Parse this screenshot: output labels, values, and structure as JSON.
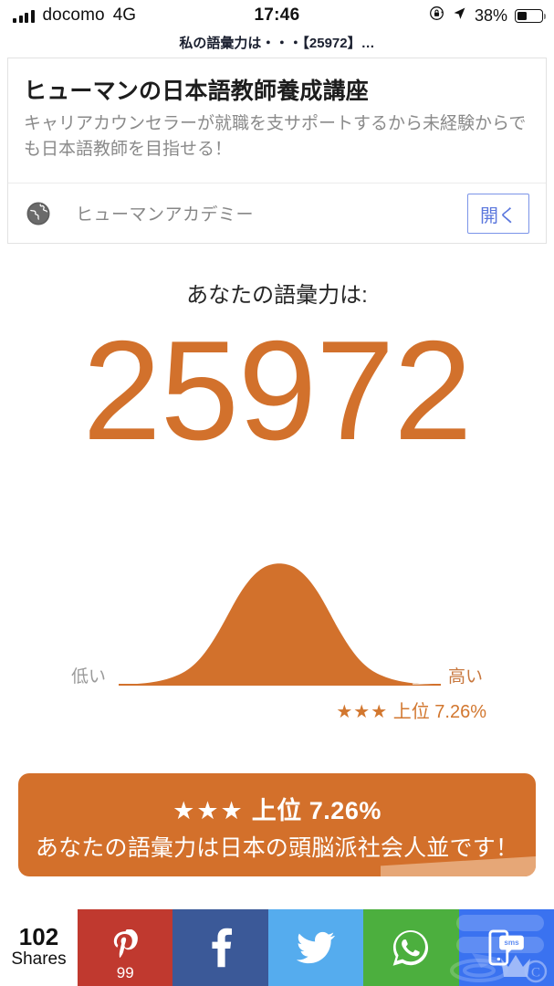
{
  "status_bar": {
    "carrier": "docomo",
    "network": "4G",
    "time": "17:46",
    "battery_percent": "38%",
    "battery_level": 38,
    "icons": [
      "signal-bars-icon",
      "orientation-lock-icon",
      "location-arrow-icon",
      "battery-icon"
    ]
  },
  "page_title": "私の語彙力は・・・【25972】…",
  "ad": {
    "title": "ヒューマンの日本語教師養成講座",
    "description": "キャリアカウンセラーが就職を支サポートするから未経験からでも日本語教師を目指せる！",
    "advertiser": "ヒューマンアカデミー",
    "advertiser_icon": "globe-icon",
    "open_label": "開く",
    "open_color": "#5b77dd"
  },
  "result": {
    "score_label": "あなたの語彙力は:",
    "score": "25972",
    "score_color": "#d2712c",
    "rank_stars": "★★★",
    "rank_text": "上位 7.26%",
    "rank_percent": 7.26,
    "banner_headline_stars": "★★★",
    "banner_headline_text": "上位 7.26%",
    "banner_subtitle": "あなたの語彙力は日本の頭脳派社会人並です！",
    "banner_color": "#d3702b"
  },
  "chart_data": {
    "type": "area",
    "title": "",
    "xlabel": "",
    "ylabel": "",
    "axis_labels": {
      "left": "低い",
      "right": "高い"
    },
    "fill_color": "#d2712c",
    "tail_color": "#e8cbb2",
    "grid": false,
    "legend": null,
    "marker": {
      "label": "上位 7.26%",
      "percentile": 92.74
    },
    "x": [
      0,
      5,
      10,
      15,
      20,
      25,
      30,
      35,
      40,
      45,
      50,
      55,
      60,
      65,
      70,
      75,
      80,
      85,
      90,
      95,
      100
    ],
    "y": [
      0.01,
      0.02,
      0.04,
      0.08,
      0.15,
      0.27,
      0.44,
      0.64,
      0.83,
      0.96,
      1.0,
      0.96,
      0.83,
      0.64,
      0.44,
      0.27,
      0.15,
      0.08,
      0.04,
      0.02,
      0.01
    ],
    "ylim": [
      0,
      1.05
    ],
    "xlim": [
      0,
      100
    ]
  },
  "share_bar": {
    "count": "102",
    "count_label": "Shares",
    "buttons": [
      {
        "name": "pinterest",
        "icon": "pinterest-icon",
        "color": "#c0392f",
        "badge": "99"
      },
      {
        "name": "facebook",
        "icon": "facebook-icon",
        "color": "#3b5998",
        "badge": ""
      },
      {
        "name": "twitter",
        "icon": "twitter-icon",
        "color": "#55acee",
        "badge": ""
      },
      {
        "name": "whatsapp",
        "icon": "whatsapp-icon",
        "color": "#4caf3e",
        "badge": ""
      },
      {
        "name": "sms",
        "icon": "sms-icon",
        "color": "#3a72f0",
        "badge": ""
      }
    ]
  }
}
